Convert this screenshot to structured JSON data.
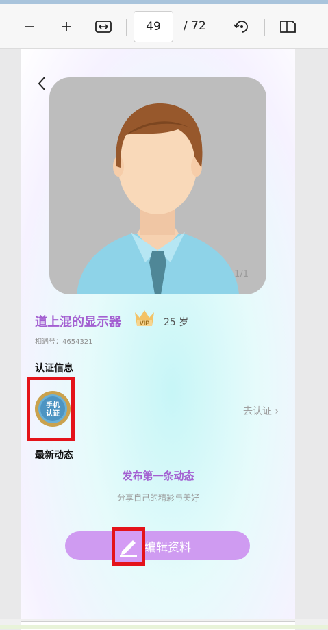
{
  "toolbar": {
    "zoom_out": "−",
    "zoom_in": "+",
    "page_current": "49",
    "page_total": "/ 72"
  },
  "profile": {
    "photo_counter": "1/1",
    "name": "道上混的显示器",
    "vip_text": "VIP",
    "age": "25 岁",
    "id_line": "相遇号：4654321"
  },
  "verification": {
    "title": "认证信息",
    "badge_line1": "手机",
    "badge_line2": "认证",
    "go_verify": "去认证 ›"
  },
  "feed": {
    "title": "最新动态",
    "publish": "发布第一条动态",
    "subtitle": "分享自己的精彩与美好"
  },
  "edit": {
    "label": "编辑资料"
  },
  "colors": {
    "accent_purple": "#a35fd1",
    "button_purple": "#cf9bf1",
    "highlight_red": "#e4131a"
  }
}
